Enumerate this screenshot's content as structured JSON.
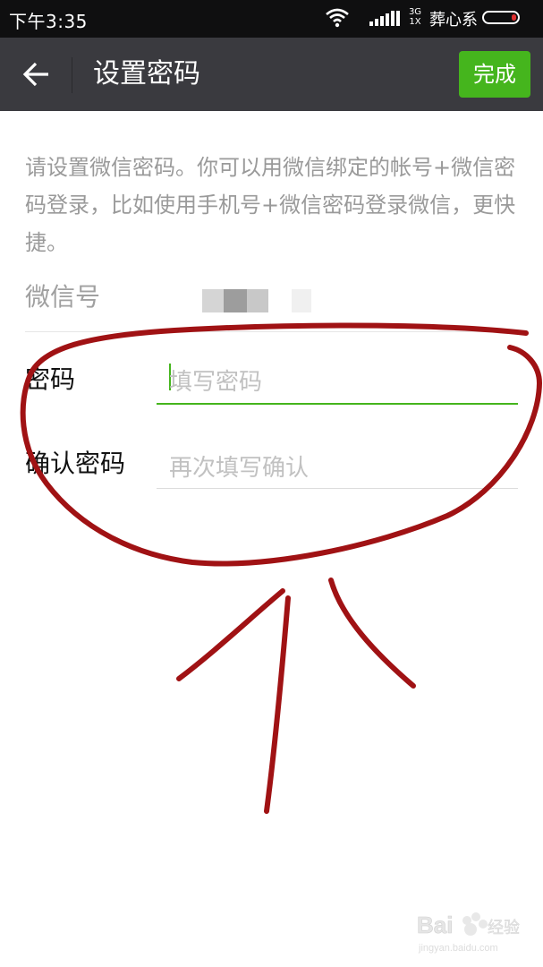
{
  "status_bar": {
    "time": "下午3:35",
    "network_type": "3G",
    "network_sub": "1X",
    "carrier": "葬心系",
    "icons": [
      "wifi-icon",
      "signal-icon",
      "battery-icon"
    ]
  },
  "app_bar": {
    "title": "设置密码",
    "done_label": "完成",
    "back_icon": "arrow-left-icon"
  },
  "description": "请设置微信密码。你可以用微信绑定的帐号+微信密码登录，比如使用手机号+微信密码登录微信，更快捷。",
  "form": {
    "wechat_id_label": "微信号",
    "password_label": "密码",
    "password_placeholder": "填写密码",
    "confirm_label": "确认密码",
    "confirm_placeholder": "再次填写确认"
  },
  "colors": {
    "accent": "#45b51d",
    "app_bar_bg": "#3a3a3f",
    "annotation": "#a01214"
  },
  "watermark": {
    "brand": "Bai",
    "brand_suffix": "经验",
    "url": "jingyan.baidu.com"
  }
}
